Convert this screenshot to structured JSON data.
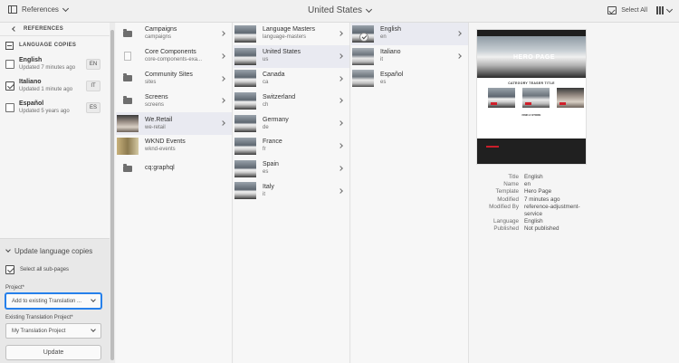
{
  "topbar": {
    "rail_label": "References",
    "path_title": "United States",
    "select_all_label": "Select All"
  },
  "rail": {
    "header": "REFERENCES",
    "section_title": "LANGUAGE COPIES",
    "language_copies": [
      {
        "name": "English",
        "updated": "Updated 7 minutes ago",
        "code": "EN",
        "checked": false
      },
      {
        "name": "Italiano",
        "updated": "Updated 1 minute ago",
        "code": "IT",
        "checked": true
      },
      {
        "name": "Español",
        "updated": "Updated 5 years ago",
        "code": "ES",
        "checked": false
      }
    ],
    "update_section_title": "Update language copies",
    "select_subpages_label": "Select all sub-pages",
    "project_label": "Project*",
    "project_value": "Add to existing Translation ...",
    "existing_project_label": "Existing Translation Project*",
    "existing_project_value": "My Translation Project",
    "update_button": "Update"
  },
  "columns": {
    "col1": [
      {
        "title": "Campaigns",
        "name": "campaigns",
        "icon": "folder-icon"
      },
      {
        "title": "Core Components",
        "name": "core-components-exa...",
        "icon": "page-icon"
      },
      {
        "title": "Community Sites",
        "name": "sites",
        "icon": "folder-icon"
      },
      {
        "title": "Screens",
        "name": "screens",
        "icon": "folder-icon"
      },
      {
        "title": "We.Retail",
        "name": "we-retail",
        "icon": "thumbnail"
      },
      {
        "title": "WKND Events",
        "name": "wknd-events",
        "icon": "thumbnail"
      },
      {
        "title": "cq:graphql",
        "name": "",
        "icon": "folder-icon"
      }
    ],
    "col2": [
      {
        "title": "Language Masters",
        "name": "language-masters"
      },
      {
        "title": "United States",
        "name": "us"
      },
      {
        "title": "Canada",
        "name": "ca"
      },
      {
        "title": "Switzerland",
        "name": "ch"
      },
      {
        "title": "Germany",
        "name": "de"
      },
      {
        "title": "France",
        "name": "fr"
      },
      {
        "title": "Spain",
        "name": "es"
      },
      {
        "title": "Italy",
        "name": "it"
      }
    ],
    "col3": [
      {
        "title": "English",
        "name": "en"
      },
      {
        "title": "Italiano",
        "name": "it"
      },
      {
        "title": "Español",
        "name": "es"
      }
    ]
  },
  "preview": {
    "hero_text": "HERO PAGE",
    "teaser_title": "CATEGORY TEASER TITLE",
    "find_store": "FIND A STORE",
    "properties": [
      {
        "label": "Title",
        "value": "English"
      },
      {
        "label": "Name",
        "value": "en"
      },
      {
        "label": "Template",
        "value": "Hero Page"
      },
      {
        "label": "Modified",
        "value": "7 minutes ago"
      },
      {
        "label": "Modified By",
        "value": "reference-adjustment-service"
      },
      {
        "label": "Language",
        "value": "English"
      },
      {
        "label": "Published",
        "value": "Not published"
      }
    ]
  },
  "colors": {
    "selected_row": "#e9eaf1",
    "focus_blue": "#2680eb",
    "accent_red": "#c91e2b"
  }
}
